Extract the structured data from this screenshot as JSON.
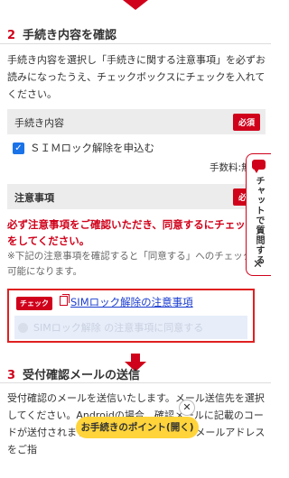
{
  "section2": {
    "number": "2",
    "title": "手続き内容を確認",
    "intro": "手続き内容を選択し「手続きに関する注意事項」を必ずお読みになったうえ、チェックボックスにチェックを入れてください。"
  },
  "procedure": {
    "header": "手続き内容",
    "required": "必須",
    "option_label": "ＳＩＭロック解除を申込む",
    "option_checked": true,
    "fee": "手数料:無"
  },
  "notes": {
    "header": "注意事項",
    "required": "必須",
    "warning": "必ず注意事項をご確認いただき、同意するにチェックをしてください。",
    "sub": "※下記の注意事項を確認すると「同意する」へのチェックが可能になります。"
  },
  "agree_box": {
    "check_badge": "チェック",
    "link_text": "SIMロック解除の注意事項",
    "agree_label": "SIMロック解除 の注意事項に同意する"
  },
  "section3": {
    "number": "3",
    "title": "受付確認メールの送信",
    "text": "受付確認のメールを送信いたします。メール送信先を選択してください。Androidの場合、確認メールに記載のコードが送付されますので、確実に確認できるメールアドレスをご指"
  },
  "chat": {
    "label": "チャットで質問する",
    "close": "✕"
  },
  "floating": {
    "close": "✕",
    "point_button": "お手続きのポイント(開く)"
  },
  "colors": {
    "accent": "#d0021b",
    "link": "#1a3ccf",
    "pill": "#ffd43b"
  }
}
